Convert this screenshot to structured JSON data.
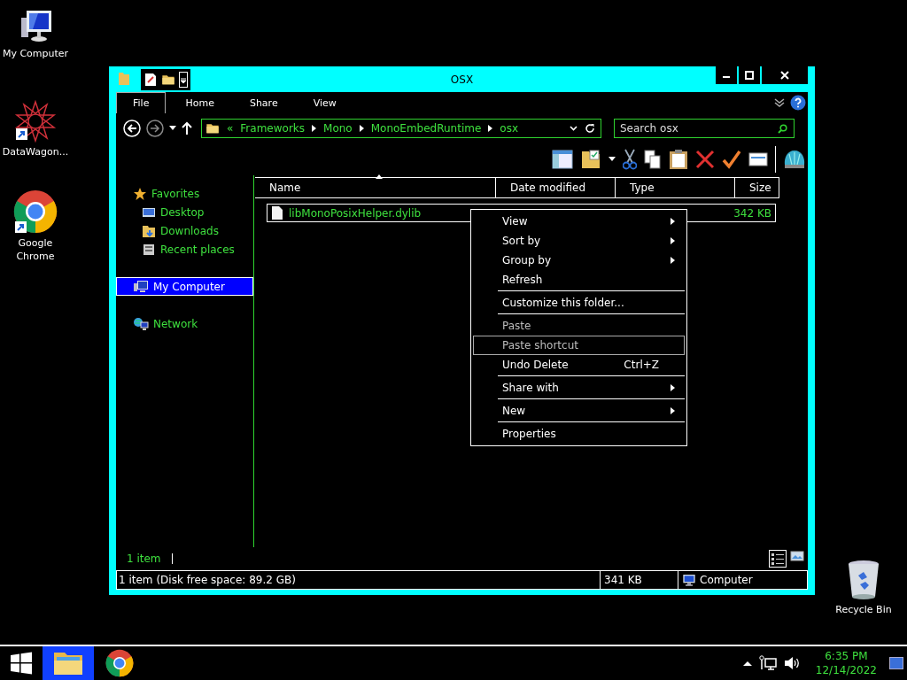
{
  "desktop_icons": [
    {
      "label": "My Computer",
      "kind": "computer"
    },
    {
      "label": "DataWagon...",
      "kind": "app"
    },
    {
      "label": "Google Chrome",
      "kind": "chrome"
    },
    {
      "label": "Recycle Bin",
      "kind": "bin"
    }
  ],
  "window": {
    "title": "OSX",
    "ribbon_tabs": [
      {
        "label": "File",
        "selected": true
      },
      {
        "label": "Home",
        "selected": false
      },
      {
        "label": "Share",
        "selected": false
      },
      {
        "label": "View",
        "selected": false
      }
    ],
    "address": {
      "overflow": "«",
      "crumbs": [
        "Frameworks",
        "Mono",
        "MonoEmbedRuntime",
        "osx"
      ]
    },
    "search": {
      "placeholder": "Search osx"
    },
    "nav": [
      {
        "label": "Favorites",
        "kind": "star",
        "selected": false,
        "children": [
          {
            "label": "Desktop",
            "kind": "desktop",
            "selected": false
          },
          {
            "label": "Downloads",
            "kind": "downloads",
            "selected": false
          },
          {
            "label": "Recent places",
            "kind": "recent",
            "selected": false
          }
        ]
      },
      {
        "label": "My Computer",
        "kind": "computer",
        "selected": true
      },
      {
        "label": "Network",
        "kind": "network",
        "selected": false
      }
    ],
    "columns": [
      "Name",
      "Date modified",
      "Type",
      "Size"
    ],
    "rows": [
      {
        "name": "libMonoPosixHelper.dylib",
        "size": "342 KB"
      }
    ],
    "item_count": "1 item",
    "status_bar": {
      "summary": "1 item (Disk free space: 89.2 GB)",
      "size": "341 KB",
      "zone": "Computer"
    }
  },
  "context_menu": [
    {
      "kind": "item",
      "label": "View",
      "submenu": true,
      "disabled": false,
      "selected": false
    },
    {
      "kind": "item",
      "label": "Sort by",
      "submenu": true,
      "disabled": false,
      "selected": false
    },
    {
      "kind": "item",
      "label": "Group by",
      "submenu": true,
      "disabled": false,
      "selected": false
    },
    {
      "kind": "item",
      "label": "Refresh",
      "submenu": false,
      "disabled": false,
      "selected": false
    },
    {
      "kind": "separator"
    },
    {
      "kind": "item",
      "label": "Customize this folder...",
      "submenu": false,
      "disabled": false,
      "selected": false
    },
    {
      "kind": "separator"
    },
    {
      "kind": "item",
      "label": "Paste",
      "submenu": false,
      "disabled": true,
      "selected": false
    },
    {
      "kind": "item",
      "label": "Paste shortcut",
      "submenu": false,
      "disabled": true,
      "selected": true
    },
    {
      "kind": "item",
      "label": "Undo Delete",
      "shortcut": "Ctrl+Z",
      "submenu": false,
      "disabled": false,
      "selected": false
    },
    {
      "kind": "separator"
    },
    {
      "kind": "item",
      "label": "Share with",
      "submenu": true,
      "disabled": false,
      "selected": false
    },
    {
      "kind": "separator"
    },
    {
      "kind": "item",
      "label": "New",
      "submenu": true,
      "disabled": false,
      "selected": false
    },
    {
      "kind": "separator"
    },
    {
      "kind": "item",
      "label": "Properties",
      "submenu": false,
      "disabled": false,
      "selected": false
    }
  ],
  "taskbar": {
    "apps": [
      {
        "kind": "explorer",
        "selected": true
      },
      {
        "kind": "chrome",
        "selected": false
      }
    ],
    "time": "6:35 PM",
    "date": "12/14/2022"
  }
}
